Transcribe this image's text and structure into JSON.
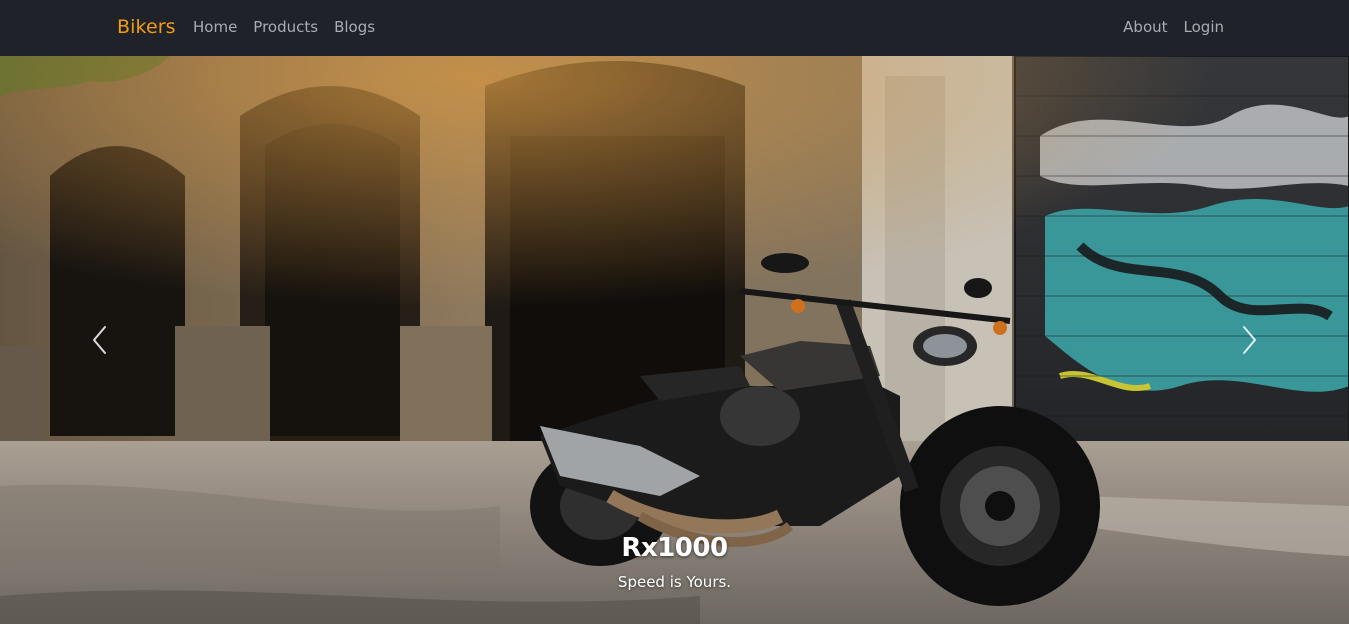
{
  "navbar": {
    "brand": "Bikers",
    "left_links": [
      "Home",
      "Products",
      "Blogs"
    ],
    "right_links": [
      "About",
      "Login"
    ],
    "brand_color": "#f39c12",
    "background": "#1f2228"
  },
  "carousel": {
    "caption_title": "Rx1000",
    "caption_text": "Speed is Yours.",
    "prev_icon": "chevron-left-icon",
    "next_icon": "chevron-right-icon",
    "photo_subject": "motorcycle parked on a street in front of a stone building and graffiti shutter"
  }
}
